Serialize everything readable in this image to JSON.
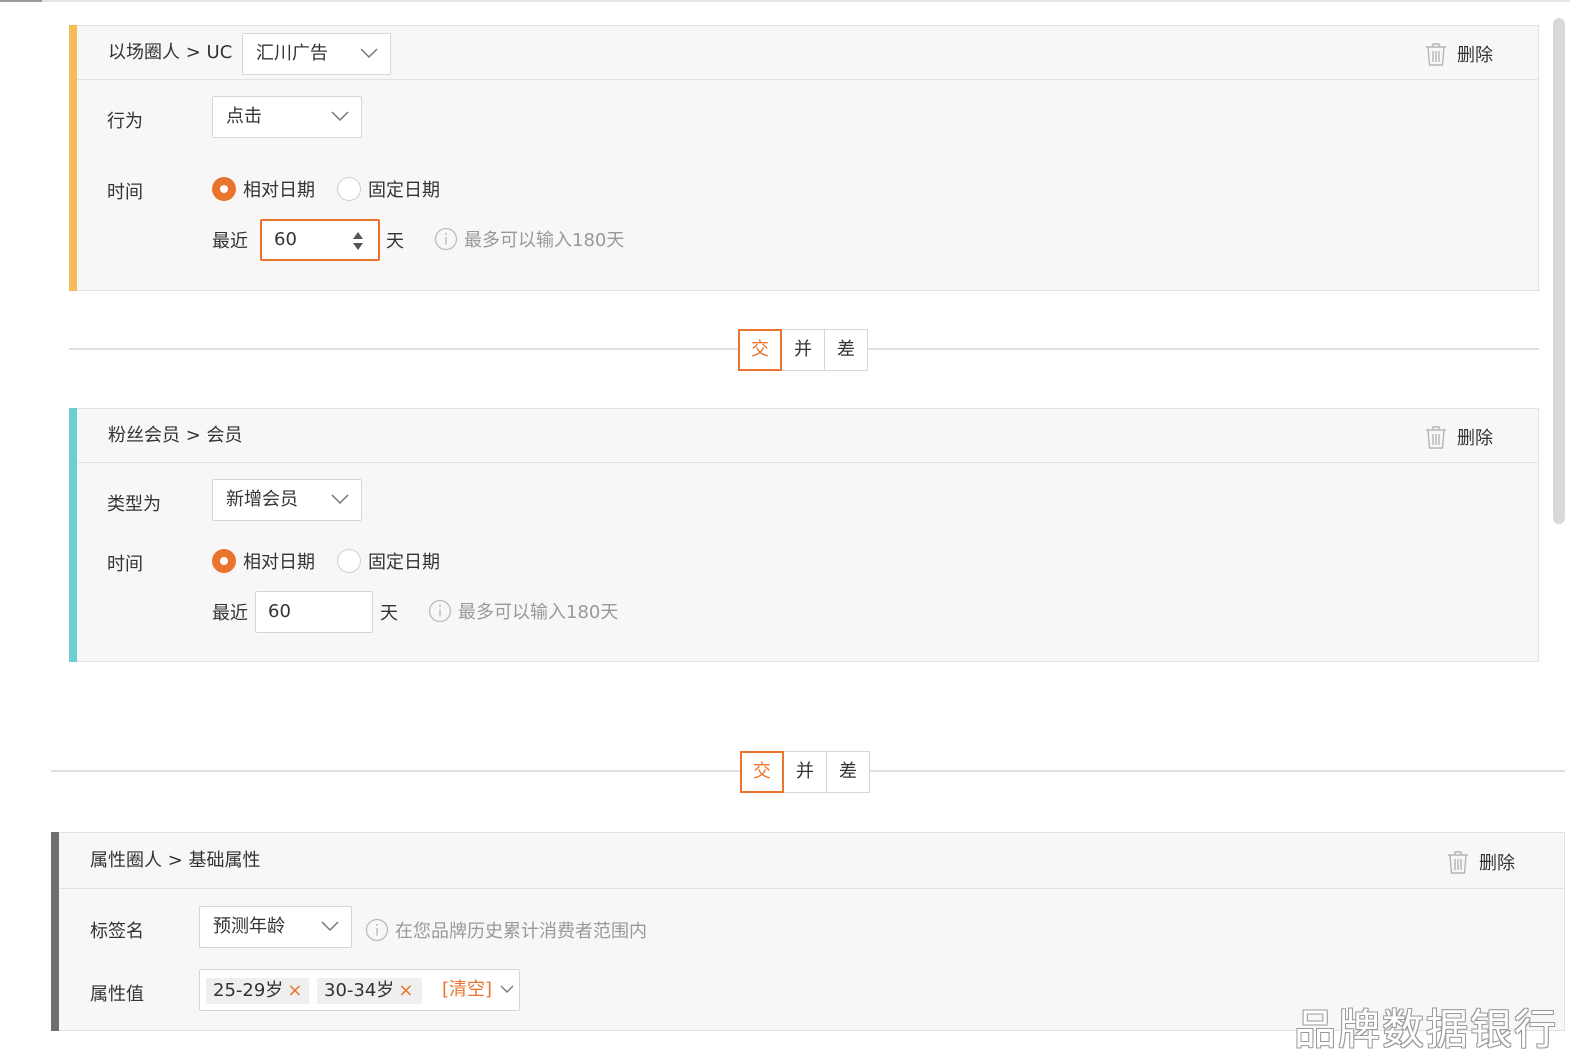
{
  "colors": {
    "accent": "#e8742e",
    "card1_bar": "#f7bc5a",
    "card2_bar": "#6dcfd1",
    "card3_bar": "#6e6e6e"
  },
  "card1": {
    "crumb": "以场圈人 > UC",
    "source_select": "汇川广告",
    "delete_label": "删除",
    "behavior_label": "行为",
    "behavior_value": "点击",
    "time_label": "时间",
    "radio_relative": "相对日期",
    "radio_fixed": "固定日期",
    "recent_label": "最近",
    "recent_value": "60",
    "unit": "天",
    "hint": "最多可以输入180天"
  },
  "ops1": {
    "intersect": "交",
    "union": "并",
    "diff": "差",
    "active": "交"
  },
  "card2": {
    "crumb": "粉丝会员 > 会员",
    "delete_label": "删除",
    "type_label": "类型为",
    "type_value": "新增会员",
    "time_label": "时间",
    "radio_relative": "相对日期",
    "radio_fixed": "固定日期",
    "recent_label": "最近",
    "recent_value": "60",
    "unit": "天",
    "hint": "最多可以输入180天"
  },
  "ops2": {
    "intersect": "交",
    "union": "并",
    "diff": "差",
    "active": "交"
  },
  "card3": {
    "crumb": "属性圈人 > 基础属性",
    "delete_label": "删除",
    "tag_label": "标签名",
    "tag_value": "预测年龄",
    "tag_hint": "在您品牌历史累计消费者范围内",
    "attr_label": "属性值",
    "tags": [
      "25-29岁",
      "30-34岁"
    ],
    "remove_symbol": "×",
    "clear_label": "[清空]"
  },
  "watermark": "品牌数据银行"
}
